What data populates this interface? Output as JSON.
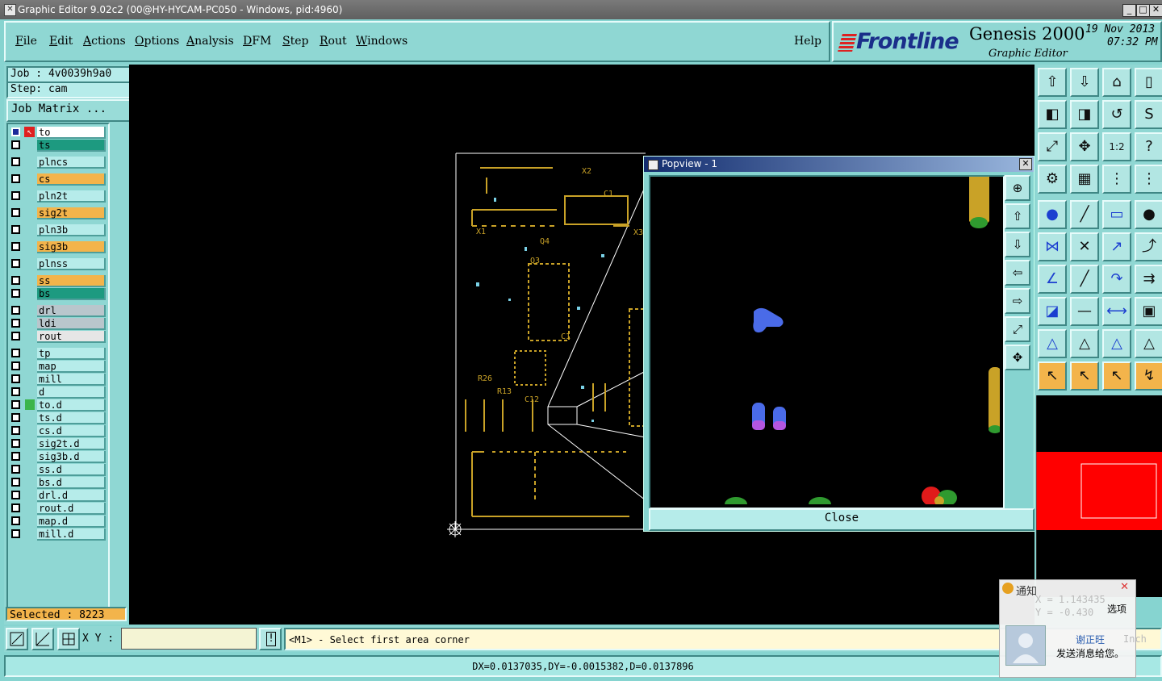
{
  "window": {
    "title": "Graphic Editor 9.02c2 (00@HY-HYCAM-PC050 - Windows, pid:4960)",
    "controls": [
      "_",
      "□",
      "✕"
    ]
  },
  "menubar": {
    "items": [
      {
        "label": "File",
        "underline": "F",
        "rest": "ile"
      },
      {
        "label": "Edit",
        "underline": "E",
        "rest": "dit"
      },
      {
        "label": "Actions",
        "underline": "A",
        "rest": "ctions"
      },
      {
        "label": "Options",
        "underline": "O",
        "rest": "ptions"
      },
      {
        "label": "Analysis",
        "underline": "A",
        "rest": "nalysis"
      },
      {
        "label": "DFM",
        "underline": "D",
        "rest": "FM"
      },
      {
        "label": "Step",
        "underline": "S",
        "rest": "tep"
      },
      {
        "label": "Rout",
        "underline": "R",
        "rest": "out"
      },
      {
        "label": "Windows",
        "underline": "W",
        "rest": "indows"
      }
    ],
    "help": "Help"
  },
  "brand": {
    "logo": "Frontline",
    "product": "Genesis 2000",
    "subtitle": "Graphic Editor",
    "date": "19 Nov 2013",
    "time": "07:32 PM"
  },
  "job": {
    "job_line": "Job : 4v0039h9a0",
    "step_line": "Step: cam",
    "matrix_button": "Job Matrix ..."
  },
  "layers": [
    {
      "name": "to",
      "color": "#ffffff",
      "work": true
    },
    {
      "name": "ts",
      "color": "#1d9a80"
    },
    {
      "name": "plncs",
      "color": "#b6ecea"
    },
    {
      "name": "cs",
      "color": "#f3b44b"
    },
    {
      "name": "pln2t",
      "color": "#b6ecea"
    },
    {
      "name": "sig2t",
      "color": "#f3b44b"
    },
    {
      "name": "pln3b",
      "color": "#b6ecea"
    },
    {
      "name": "sig3b",
      "color": "#f3b44b"
    },
    {
      "name": "plnss",
      "color": "#b6ecea"
    },
    {
      "name": "ss",
      "color": "#f3b44b"
    },
    {
      "name": "bs",
      "color": "#1d9a80"
    },
    {
      "name": "drl",
      "color": "#b9c6cc"
    },
    {
      "name": "ldi",
      "color": "#b9c6cc"
    },
    {
      "name": "rout",
      "color": "#e6e6e6"
    },
    {
      "name": "tp",
      "color": "#b6ecea"
    },
    {
      "name": "map",
      "color": "#b6ecea"
    },
    {
      "name": "mill",
      "color": "#b6ecea"
    },
    {
      "name": "d",
      "color": "#b6ecea"
    },
    {
      "name": "to.d",
      "color": "#b6ecea",
      "marker": "#3bb54a"
    },
    {
      "name": "ts.d",
      "color": "#b6ecea"
    },
    {
      "name": "cs.d",
      "color": "#b6ecea"
    },
    {
      "name": "sig2t.d",
      "color": "#b6ecea"
    },
    {
      "name": "sig3b.d",
      "color": "#b6ecea"
    },
    {
      "name": "ss.d",
      "color": "#b6ecea"
    },
    {
      "name": "bs.d",
      "color": "#b6ecea"
    },
    {
      "name": "drl.d",
      "color": "#b6ecea"
    },
    {
      "name": "rout.d",
      "color": "#b6ecea"
    },
    {
      "name": "map.d",
      "color": "#b6ecea"
    },
    {
      "name": "mill.d",
      "color": "#b6ecea"
    }
  ],
  "selected": "Selected : 8223",
  "board_labels": [
    "X2",
    "C1",
    "X1",
    "X3",
    "Q4",
    "Q3",
    "C1",
    "R13",
    "R26",
    "C12"
  ],
  "popview": {
    "title": "Popview - 1",
    "close_button": "Close"
  },
  "command": {
    "xy_label": "X Y :",
    "xy_value": "",
    "exclaim": "!",
    "prompt": "<M1> - Select first area corner"
  },
  "status": "DX=0.0137035,DY=-0.0015382,D=0.0137896",
  "notification": {
    "title": "通知",
    "options": "选项",
    "sender": "谢正旺",
    "message": "发送消息给您。",
    "under_x": "X = 1.143435",
    "under_y": "Y = -0.430",
    "under_unit": "Inch"
  },
  "colors": {
    "panel": "#8fd7d3",
    "canvas": "#000000",
    "trace": "#c9a227",
    "outline": "#ffffff",
    "pad_blue": "#4a6be8",
    "pad_green": "#2f9a2f",
    "pad_red": "#e01a1a",
    "preview_red": "#ff0000"
  }
}
